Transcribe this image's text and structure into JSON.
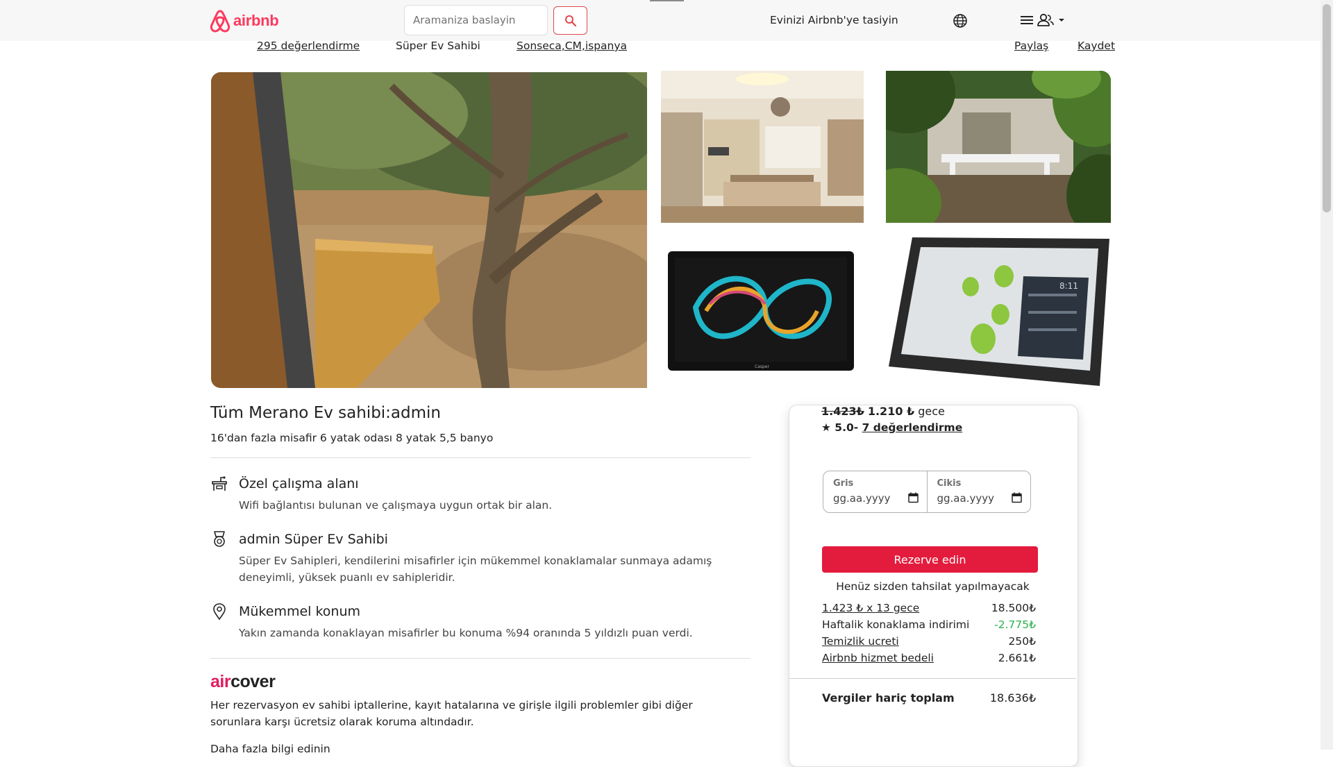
{
  "header": {
    "logo_text": "airbnb",
    "search_placeholder": "Aramaniza baslayin",
    "host_link": "Evinizi Airbnb'ye tasiyin"
  },
  "subbar": {
    "reviews": "295 değerlendirme",
    "superhost": "Süper Ev Sahibi",
    "location": "Sonseca,CM,ispanya",
    "share": "Paylaş",
    "save": "Kaydet"
  },
  "listing": {
    "title": "Tüm Merano Ev sahibi:admin",
    "meta": "16'dan fazla misafir 6 yatak odası 8 yatak 5,5 banyo"
  },
  "features": [
    {
      "title": "Özel çalışma alanı",
      "desc": "Wifi bağlantısı bulunan ve çalışmaya uygun ortak bir alan.",
      "icon": "workspace-icon"
    },
    {
      "title": "admin Süper Ev Sahibi",
      "desc": "Süper Ev Sahipleri, kendilerini misafirler için mükemmel konaklamalar sunmaya adamış deneyimli, yüksek puanlı ev sahipleridir.",
      "icon": "medal-icon"
    },
    {
      "title": "Mükemmel konum",
      "desc": "Yakın zamanda konaklayan misafirler bu konuma %94 oranında 5 yıldızlı puan verdi.",
      "icon": "location-pin-icon"
    }
  ],
  "aircover": {
    "logo_air": "air",
    "logo_cover": "cover",
    "text": "Her rezervasyon ev sahibi iptallerine, kayıt hatalarına ve girişle ilgili problemler gibi diğer sorunlara karşı ücretsiz olarak koruma altındadır.",
    "cutoff": "Daha fazla bilgi edinin"
  },
  "booking": {
    "price_old": "1.423₺",
    "price_new": "1.210 ₺",
    "price_unit": "gece",
    "rating": "★ 5.0-",
    "reviews_link": "7 değerlendirme",
    "checkin_label": "Gris",
    "checkin_value": "gg.aa.yyyy",
    "checkout_label": "Cikis",
    "checkout_value": "gg.aa.yyyy",
    "reserve_label": "Rezerve edin",
    "no_charge": "Henüz sizden tahsilat yapılmayacak",
    "fees": [
      {
        "label": "1.423 ₺ x 13 gece",
        "value": "18.500₺"
      },
      {
        "label": "Haftalik konaklama indirimi",
        "value": "-2.775₺"
      },
      {
        "label": "Temizlik ucreti",
        "value": "250₺"
      },
      {
        "label": "Airbnb hizmet bedeli",
        "value": "2.661₺"
      }
    ],
    "total_label": "Vergiler hariç toplam",
    "total_value": "18.636₺"
  },
  "colors": {
    "brand": "#ff385c",
    "reserve": "#e31c3d",
    "discount": "#2bb24c"
  }
}
